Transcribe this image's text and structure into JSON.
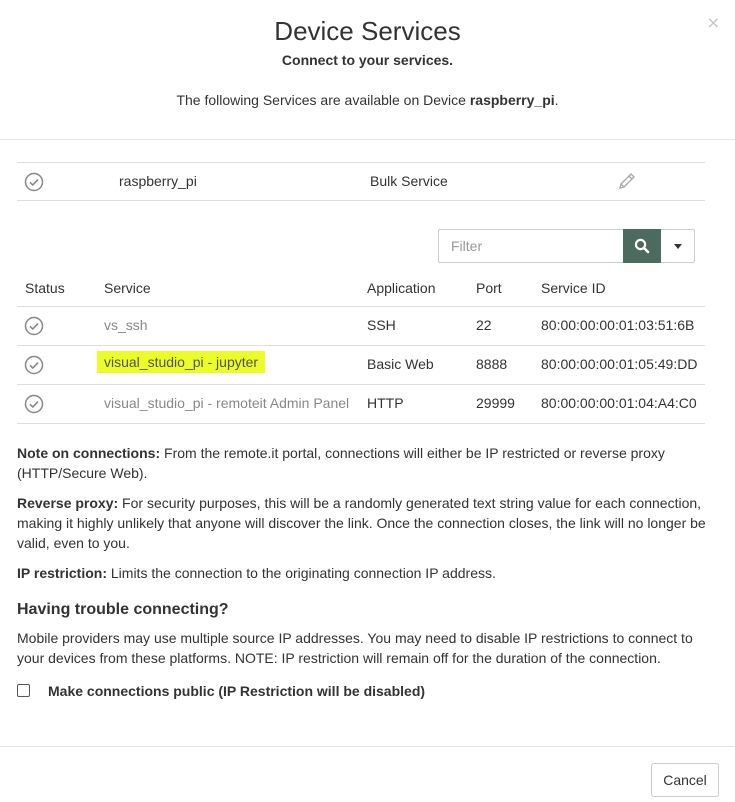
{
  "header": {
    "title": "Device Services",
    "subtitle": "Connect to your services.",
    "intro_prefix": "The following Services are available on Device ",
    "device_name": "raspberry_pi",
    "intro_suffix": ".",
    "close_label": "×"
  },
  "bulk": {
    "name": "raspberry_pi",
    "type": "Bulk Service"
  },
  "filter": {
    "placeholder": "Filter"
  },
  "table": {
    "columns": [
      "Status",
      "Service",
      "Application",
      "Port",
      "Service ID"
    ],
    "rows": [
      {
        "service": "vs_ssh",
        "application": "SSH",
        "port": "22",
        "service_id": "80:00:00:00:01:03:51:6B"
      },
      {
        "service": "visual_studio_pi - jupyter",
        "application": "Basic Web",
        "port": "8888",
        "service_id": "80:00:00:00:01:05:49:DD"
      },
      {
        "service": "visual_studio_pi - remoteit Admin Panel",
        "application": "HTTP",
        "port": "29999",
        "service_id": "80:00:00:00:01:04:A4:C0"
      }
    ]
  },
  "notes": {
    "connections_label": "Note on connections:",
    "connections_text": " From the remote.it portal, connections will either be IP restricted or reverse proxy (HTTP/Secure Web).",
    "reverse_label": "Reverse proxy:",
    "reverse_text": " For security purposes, this will be a randomly generated text string value for each connection, making it highly unlikely that anyone will discover the link. Once the connection closes, the link will no longer be valid, even to you.",
    "ip_label": "IP restriction:",
    "ip_text": " Limits the connection to the originating connection IP address."
  },
  "trouble": {
    "heading": "Having trouble connecting?",
    "text": "Mobile providers may use multiple source IP addresses. You may need to disable IP restrictions to connect to your devices from these platforms. NOTE: IP restriction will remain off for the duration of the connection."
  },
  "public_option": {
    "label": "Make connections public (IP Restriction will be disabled)",
    "checked": false
  },
  "footer": {
    "cancel_label": "Cancel"
  },
  "colors": {
    "search_button": "#4d6a5f",
    "highlight": "#ecfc2a",
    "check_icon": "#888888"
  }
}
